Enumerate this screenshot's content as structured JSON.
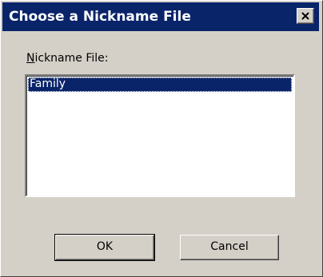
{
  "window": {
    "title": "Choose a Nickname File",
    "close_icon": "close-icon"
  },
  "field": {
    "mnemonic": "N",
    "label_rest": "ickname File:"
  },
  "list": {
    "items": [
      "Family"
    ],
    "selected_index": 0
  },
  "buttons": {
    "ok_label": "OK",
    "cancel_label": "Cancel"
  },
  "colors": {
    "titlebar": "#0a246a",
    "selection": "#0a246a",
    "face": "#d4d0c8"
  }
}
